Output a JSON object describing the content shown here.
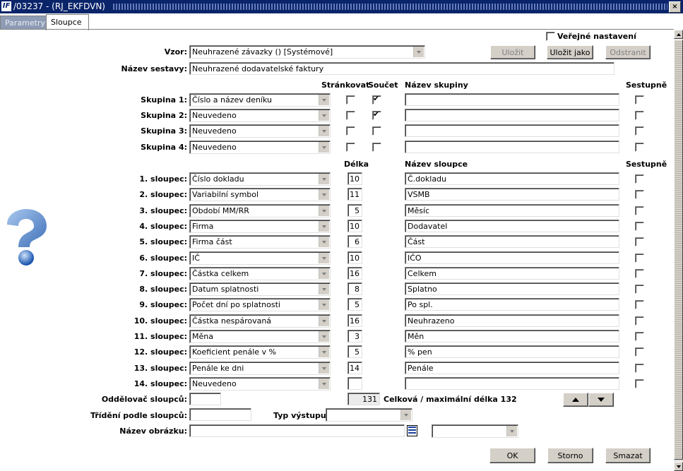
{
  "window": {
    "title": "/03237 - (RJ_EKFDVN)",
    "app_icon": "IF",
    "close_symbol": "×"
  },
  "tabs": [
    {
      "label": "Parametry",
      "active": false
    },
    {
      "label": "Sloupce",
      "active": true
    }
  ],
  "public_setting": {
    "label": "Veřejné nastavení",
    "checked": false
  },
  "template": {
    "label": "Vzor:",
    "value": "Neuhrazené závazky  ()  [Systémové]"
  },
  "buttons": {
    "save": "Uložit",
    "save_as": "Uložit jako",
    "remove": "Odstranit",
    "ok": "OK",
    "cancel": "Storno",
    "delete": "Smazat"
  },
  "report_name": {
    "label": "Název sestavy:",
    "value": "Neuhrazené dodavatelské faktury"
  },
  "group_headers": {
    "paging": "Stránkovat",
    "sum": "Součet",
    "group_name": "Název skupiny",
    "descending": "Sestupně"
  },
  "groups": [
    {
      "label": "Skupina 1:",
      "value": "Číslo a název deníku",
      "paging": false,
      "sum": true,
      "name": "",
      "descending": false
    },
    {
      "label": "Skupina 2:",
      "value": "Neuvedeno",
      "paging": false,
      "sum": true,
      "name": "",
      "descending": false
    },
    {
      "label": "Skupina 3:",
      "value": "Neuvedeno",
      "paging": false,
      "sum": false,
      "name": "",
      "descending": false
    },
    {
      "label": "Skupina 4:",
      "value": "Neuvedeno",
      "paging": false,
      "sum": false,
      "name": "",
      "descending": false
    }
  ],
  "column_headers": {
    "length": "Délka",
    "column_name": "Název sloupce",
    "descending": "Sestupně"
  },
  "columns": [
    {
      "label": "1. sloupec:",
      "value": "Číslo dokladu",
      "length": "10",
      "name": "Č.dokladu",
      "descending": false
    },
    {
      "label": "2. sloupec:",
      "value": "Variabilní symbol",
      "length": "11",
      "name": "VSMB",
      "descending": false
    },
    {
      "label": "3. sloupec:",
      "value": "Období MM/RR",
      "length": "5",
      "name": "Měsíc",
      "descending": false
    },
    {
      "label": "4. sloupec:",
      "value": "Firma",
      "length": "10",
      "name": "Dodavatel",
      "descending": false
    },
    {
      "label": "5. sloupec:",
      "value": "Firma část",
      "length": "6",
      "name": "Část",
      "descending": false
    },
    {
      "label": "6. sloupec:",
      "value": "IČ",
      "length": "10",
      "name": "IČO",
      "descending": false
    },
    {
      "label": "7. sloupec:",
      "value": "Částka celkem",
      "length": "16",
      "name": "Celkem",
      "descending": false
    },
    {
      "label": "8. sloupec:",
      "value": "Datum splatnosti",
      "length": "8",
      "name": "Splatno",
      "descending": false
    },
    {
      "label": "9. sloupec:",
      "value": "Počet dní po splatnosti",
      "length": "5",
      "name": "Po spl.",
      "descending": false
    },
    {
      "label": "10. sloupec:",
      "value": "Částka nespárovaná",
      "length": "16",
      "name": "Neuhrazeno",
      "descending": false
    },
    {
      "label": "11. sloupec:",
      "value": "Měna",
      "length": "3",
      "name": "Měn",
      "descending": false
    },
    {
      "label": "12. sloupec:",
      "value": "Koeficient penále v %",
      "length": "5",
      "name": "% pen",
      "descending": false
    },
    {
      "label": "13. sloupec:",
      "value": "Penále ke dni",
      "length": "14",
      "name": "Penále",
      "descending": false
    },
    {
      "label": "14. sloupec:",
      "value": "Neuvedeno",
      "length": "",
      "name": "",
      "descending": false
    }
  ],
  "separator": {
    "label": "Oddělovač sloupců:",
    "value": ""
  },
  "total_length": {
    "value": "131",
    "label": "Celková / maximální délka 132"
  },
  "sorting": {
    "label": "Třídění podle sloupců:",
    "value": ""
  },
  "output_type": {
    "label": "Typ výstupu:",
    "value": ""
  },
  "image_name": {
    "label": "Název obrázku:",
    "value": "",
    "select_value": ""
  },
  "icons": {
    "help": "question-mark-icon",
    "move_up": "arrow-up-icon",
    "move_down": "arrow-down-icon",
    "list": "list-icon"
  },
  "colors": {
    "titlebar": "#0a246a",
    "inactive_tab": "#8e9bb4",
    "button_face": "#d4d0c8",
    "help_icon": "#3a7fd0"
  }
}
